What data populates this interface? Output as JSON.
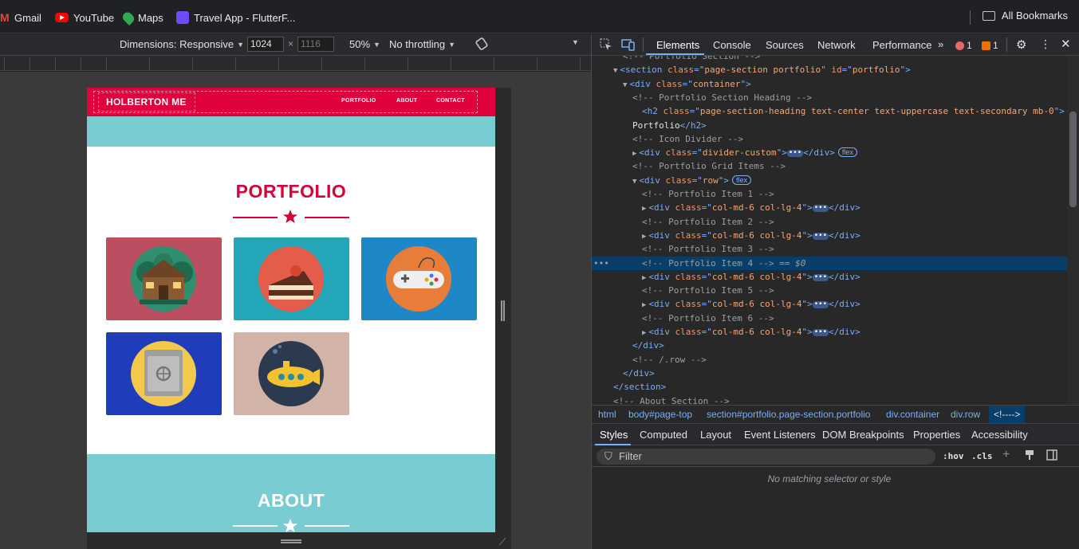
{
  "bookmarks": {
    "items": [
      {
        "label": "Gmail",
        "icon": "gmail-icon",
        "color": "#ea4335"
      },
      {
        "label": "YouTube",
        "icon": "youtube-icon",
        "color": "#ff0000"
      },
      {
        "label": "Maps",
        "icon": "maps-icon",
        "color": "#34a853"
      },
      {
        "label": "Travel App - FlutterF...",
        "icon": "flutterflow-icon",
        "color": "#6f4bff"
      }
    ],
    "all_label": "All Bookmarks"
  },
  "device_toolbar": {
    "dimensions_label": "Dimensions: Responsive",
    "width": "1024",
    "height_placeholder": "1116",
    "zoom": "50%",
    "throttling": "No throttling"
  },
  "site": {
    "brand": "HOLBERTON ME",
    "nav": [
      "PORTFOLIO",
      "ABOUT",
      "CONTACT"
    ],
    "portfolio_title": "PORTFOLIO",
    "about_title": "ABOUT",
    "tiles": [
      {
        "name": "cabin",
        "bg": "#bc4e62"
      },
      {
        "name": "cake",
        "bg": "#22a6b8"
      },
      {
        "name": "game-controller",
        "bg": "#1e88c7"
      },
      {
        "name": "safe",
        "bg": "#1f3dbb"
      },
      {
        "name": "submarine",
        "bg": "#d1b4a7"
      }
    ],
    "accent": "#e0003c",
    "teal": "#79ccd1"
  },
  "devtools": {
    "tabs": [
      "Elements",
      "Console",
      "Sources",
      "Network",
      "Performance"
    ],
    "errors": "1",
    "warnings": "1",
    "code_lines": [
      {
        "indent": 2,
        "kind": "comment",
        "text": "<!-- Portfolio Section -->"
      },
      {
        "indent": 1,
        "kind": "open",
        "tri": "▼",
        "tag": "section",
        "attrs": [
          [
            "class",
            "page-section portfolio"
          ],
          [
            "id",
            "portfolio"
          ]
        ]
      },
      {
        "indent": 2,
        "kind": "open",
        "tri": "▼",
        "tag": "div",
        "attrs": [
          [
            "class",
            "container"
          ]
        ]
      },
      {
        "indent": 3,
        "kind": "comment",
        "text": "<!-- Portfolio Section Heading -->"
      },
      {
        "indent": 3,
        "kind": "open",
        "tri": "",
        "tag": "h2",
        "attrs": [
          [
            "class",
            "page-section-heading text-center text-uppercase text-secondary mb-0"
          ]
        ]
      },
      {
        "indent": 3,
        "kind": "text",
        "text": "Portfolio",
        "close": "h2"
      },
      {
        "indent": 3,
        "kind": "comment",
        "text": "<!-- Icon Divider -->"
      },
      {
        "indent": 3,
        "kind": "collapsed",
        "tri": "▶",
        "tag": "div",
        "attrs": [
          [
            "class",
            "divider-custom"
          ]
        ],
        "pill": "flex"
      },
      {
        "indent": 3,
        "kind": "comment",
        "text": "<!-- Portfolio Grid Items -->"
      },
      {
        "indent": 3,
        "kind": "open",
        "tri": "▼",
        "tag": "div",
        "attrs": [
          [
            "class",
            "row"
          ]
        ],
        "pill": "flex"
      },
      {
        "indent": 4,
        "kind": "comment",
        "text": "<!-- Portfolio Item 1 -->"
      },
      {
        "indent": 4,
        "kind": "collapsed",
        "tri": "▶",
        "tag": "div",
        "attrs": [
          [
            "class",
            "col-md-6 col-lg-4"
          ]
        ]
      },
      {
        "indent": 4,
        "kind": "comment",
        "text": "<!-- Portfolio Item 2 -->"
      },
      {
        "indent": 4,
        "kind": "collapsed",
        "tri": "▶",
        "tag": "div",
        "attrs": [
          [
            "class",
            "col-md-6 col-lg-4"
          ]
        ]
      },
      {
        "indent": 4,
        "kind": "comment",
        "text": "<!-- Portfolio Item 3 -->"
      },
      {
        "indent": 4,
        "kind": "comment",
        "text": "<!-- Portfolio Item 4 -->",
        "selected": true,
        "suffix": " == $0"
      },
      {
        "indent": 4,
        "kind": "collapsed",
        "tri": "▶",
        "tag": "div",
        "attrs": [
          [
            "class",
            "col-md-6 col-lg-4"
          ]
        ]
      },
      {
        "indent": 4,
        "kind": "comment",
        "text": "<!-- Portfolio Item 5 -->"
      },
      {
        "indent": 4,
        "kind": "collapsed",
        "tri": "▶",
        "tag": "div",
        "attrs": [
          [
            "class",
            "col-md-6 col-lg-4"
          ]
        ]
      },
      {
        "indent": 4,
        "kind": "comment",
        "text": "<!-- Portfolio Item 6 -->"
      },
      {
        "indent": 4,
        "kind": "collapsed",
        "tri": "▶",
        "tag": "div",
        "attrs": [
          [
            "class",
            "col-md-6 col-lg-4"
          ]
        ]
      },
      {
        "indent": 3,
        "kind": "close",
        "tag": "div"
      },
      {
        "indent": 3,
        "kind": "comment",
        "text": "<!-- /.row -->"
      },
      {
        "indent": 2,
        "kind": "close",
        "tag": "div"
      },
      {
        "indent": 1,
        "kind": "close",
        "tag": "section"
      },
      {
        "indent": 1,
        "kind": "comment",
        "text": "<!-- About Section -->"
      }
    ],
    "breadcrumbs": [
      "html",
      "body#page-top",
      "section#portfolio.page-section.portfolio",
      "div.container",
      "div.row",
      "<!---->"
    ],
    "subtabs": [
      "Styles",
      "Computed",
      "Layout",
      "Event Listeners",
      "DOM Breakpoints",
      "Properties",
      "Accessibility"
    ],
    "filter_placeholder": "Filter",
    "hov_label": ":hov",
    "cls_label": ".cls",
    "no_match": "No matching selector or style"
  }
}
